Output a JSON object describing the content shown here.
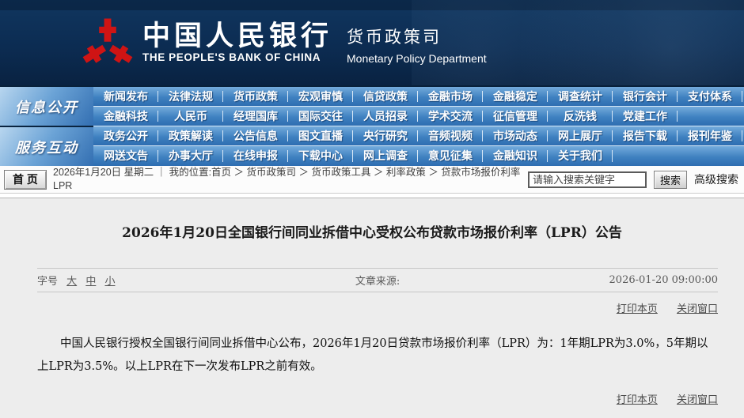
{
  "colors": {
    "header_navy": "#0c2c52",
    "dark_line": "#0a2440",
    "nav_top": "#74abdc",
    "nav_mid": "#3f81c0",
    "nav_bottom": "#2e6db1",
    "label_light": "#b8d6ef",
    "separator": "#d6e7f6",
    "logo_red": "#cf1414",
    "content_bg": "#ededed"
  },
  "header": {
    "bank_name_cn": "中国人民银行",
    "bank_name_en": "THE PEOPLE'S BANK OF CHINA",
    "dept_name_cn": "货币政策司",
    "dept_name_en": "Monetary Policy Department"
  },
  "nav": {
    "sections": [
      {
        "label": "信息公开",
        "rows": [
          [
            "新闻发布",
            "法律法规",
            "货币政策",
            "宏观审慎",
            "信贷政策",
            "金融市场",
            "金融稳定",
            "调查统计",
            "银行会计",
            "支付体系"
          ],
          [
            "金融科技",
            "人民币",
            "经理国库",
            "国际交往",
            "人员招录",
            "学术交流",
            "征信管理",
            "反洗钱",
            "党建工作"
          ]
        ]
      },
      {
        "label": "服务互动",
        "rows": [
          [
            "政务公开",
            "政策解读",
            "公告信息",
            "图文直播",
            "央行研究",
            "音频视频",
            "市场动态",
            "网上展厅",
            "报告下载",
            "报刊年鉴"
          ],
          [
            "网送文告",
            "办事大厅",
            "在线申报",
            "下载中心",
            "网上调查",
            "意见征集",
            "金融知识",
            "关于我们"
          ]
        ]
      }
    ]
  },
  "crumb": {
    "home_button": "首 页",
    "line1": "2026年1月20日 星期二 ｜ 我的位置:首页 ＞ 货币政策司 ＞ 货币政策工具 ＞ 利率政策 ＞ 贷款市场报价利率",
    "line2": "LPR",
    "search_placeholder": "请输入搜索关键字",
    "search_button": "搜索",
    "advanced_search": "高级搜索"
  },
  "article": {
    "title": "2026年1月20日全国银行间同业拆借中心受权公布贷款市场报价利率（LPR）公告",
    "font_size_label": "字号",
    "font_sizes": [
      "大",
      "中",
      "小"
    ],
    "source_label": "文章来源:",
    "datetime": "2026-01-20 09:00:00",
    "print_link": "打印本页",
    "close_link": "关闭窗口",
    "body": "中国人民银行授权全国银行间同业拆借中心公布，2026年1月20日贷款市场报价利率（LPR）为：1年期LPR为3.0%，5年期以上LPR为3.5%。以上LPR在下一次发布LPR之前有效。"
  }
}
